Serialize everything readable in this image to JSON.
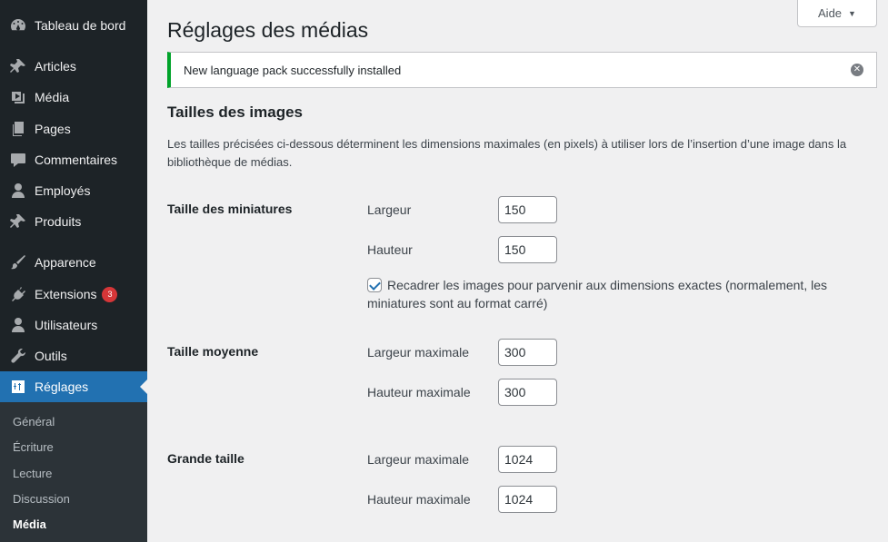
{
  "sidebar": {
    "items": [
      {
        "label": "Tableau de bord",
        "icon": "dashboard-icon"
      },
      {
        "label": "Articles",
        "icon": "pin-icon"
      },
      {
        "label": "Média",
        "icon": "media-icon"
      },
      {
        "label": "Pages",
        "icon": "pages-icon"
      },
      {
        "label": "Commentaires",
        "icon": "comment-icon"
      },
      {
        "label": "Employés",
        "icon": "user-icon"
      },
      {
        "label": "Produits",
        "icon": "pin-icon"
      },
      {
        "label": "Apparence",
        "icon": "brush-icon"
      },
      {
        "label": "Extensions",
        "icon": "plugin-icon",
        "badge": "3"
      },
      {
        "label": "Utilisateurs",
        "icon": "user-icon"
      },
      {
        "label": "Outils",
        "icon": "wrench-icon"
      },
      {
        "label": "Réglages",
        "icon": "settings-icon",
        "active": true
      }
    ],
    "submenu": [
      "Général",
      "Écriture",
      "Lecture",
      "Discussion",
      "Média"
    ]
  },
  "header": {
    "help_label": "Aide",
    "title": "Réglages des médias"
  },
  "notice": {
    "text": "New language pack successfully installed"
  },
  "section": {
    "title": "Tailles des images",
    "description": "Les tailles précisées ci-dessous déterminent les dimensions maximales (en pixels) à utiliser lors de l’insertion d’une image dans la bibliothèque de médias."
  },
  "thumbnail": {
    "label": "Taille des miniatures",
    "width_label": "Largeur",
    "width_value": "150",
    "height_label": "Hauteur",
    "height_value": "150",
    "crop_label": "Recadrer les images pour parvenir aux dimensions exactes (normalement, les miniatures sont au format carré)",
    "crop_checked": true
  },
  "medium": {
    "label": "Taille moyenne",
    "width_label": "Largeur maximale",
    "width_value": "300",
    "height_label": "Hauteur maximale",
    "height_value": "300"
  },
  "large": {
    "label": "Grande taille",
    "width_label": "Largeur maximale",
    "width_value": "1024",
    "height_label": "Hauteur maximale",
    "height_value": "1024"
  },
  "colors": {
    "sidebar_bg": "#1d2327",
    "accent": "#2271b1",
    "success": "#00a32a",
    "badge": "#d63638"
  }
}
